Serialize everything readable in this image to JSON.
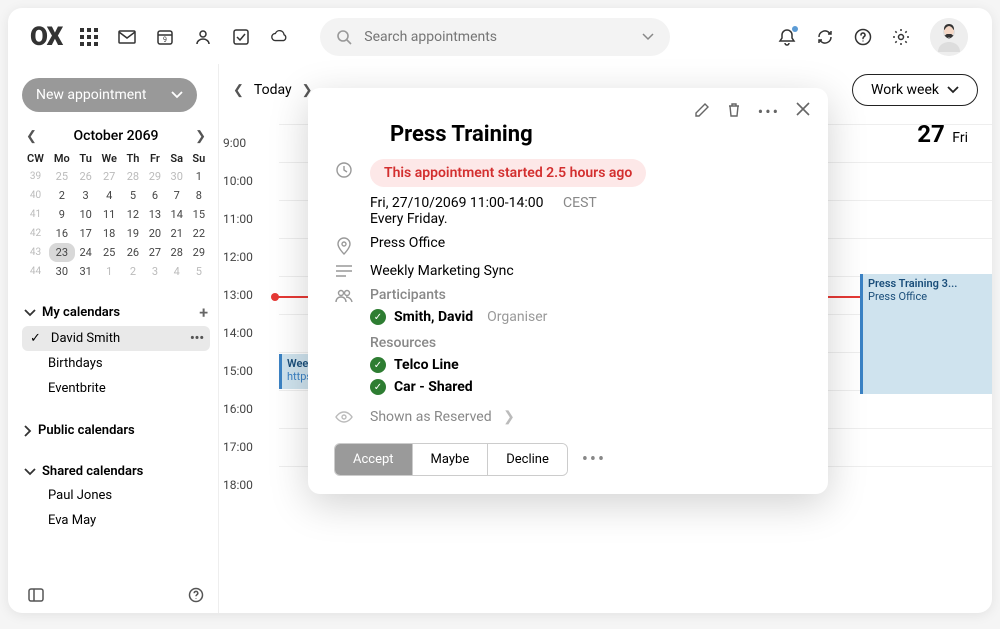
{
  "topbar": {
    "search_placeholder": "Search appointments"
  },
  "sidebar": {
    "new_appointment": "New appointment",
    "month_title": "October 2069",
    "calendars_header": "My calendars",
    "calendars": [
      {
        "name": "David Smith",
        "active": true
      },
      {
        "name": "Birthdays",
        "active": false
      },
      {
        "name": "Eventbrite",
        "active": false
      }
    ],
    "public_header": "Public calendars",
    "shared_header": "Shared calendars",
    "shared": [
      {
        "name": "Paul Jones"
      },
      {
        "name": "Eva May"
      }
    ],
    "mini": {
      "dow": [
        "CW",
        "Mo",
        "Tu",
        "We",
        "Th",
        "Fr",
        "Sa",
        "Su"
      ],
      "rows": [
        {
          "cw": "39",
          "days": [
            "25",
            "26",
            "27",
            "28",
            "29",
            "30",
            "1"
          ],
          "dim": [
            0,
            1,
            2,
            3,
            4,
            5
          ]
        },
        {
          "cw": "40",
          "days": [
            "2",
            "3",
            "4",
            "5",
            "6",
            "7",
            "8"
          ]
        },
        {
          "cw": "41",
          "days": [
            "9",
            "10",
            "11",
            "12",
            "13",
            "14",
            "15"
          ]
        },
        {
          "cw": "42",
          "days": [
            "16",
            "17",
            "18",
            "19",
            "20",
            "21",
            "22"
          ]
        },
        {
          "cw": "43",
          "days": [
            "23",
            "24",
            "25",
            "26",
            "27",
            "28",
            "29"
          ],
          "today": 0
        },
        {
          "cw": "44",
          "days": [
            "30",
            "31",
            "1",
            "2",
            "3",
            "4",
            "5"
          ],
          "dim": [
            2,
            3,
            4,
            5,
            6
          ]
        }
      ]
    }
  },
  "calendar": {
    "today_label": "Today",
    "view_label": "Work week",
    "day_num": "27",
    "day_name": "Fri",
    "hours": [
      "9:00",
      "10:00",
      "11:00",
      "12:00",
      "13:00",
      "14:00",
      "15:00",
      "16:00",
      "17:00",
      "18:00"
    ],
    "side_apt_title": "Press Training 3...",
    "side_apt_loc": "Press Office",
    "left_apt_title": "Weel",
    "left_apt_sub": "https"
  },
  "popup": {
    "title": "Press Training",
    "alert": "This appointment started 2.5 hours ago",
    "datetime": "Fri, 27/10/2069 11:00-14:00",
    "tz": "CEST",
    "recurrence": "Every Friday.",
    "location": "Press Office",
    "description": "Weekly Marketing Sync",
    "participants_label": "Participants",
    "participants": [
      {
        "name": "Smith, David",
        "role": "Organiser"
      }
    ],
    "resources_label": "Resources",
    "resources": [
      {
        "name": "Telco Line"
      },
      {
        "name": "Car - Shared"
      }
    ],
    "shown_as": "Shown as Reserved",
    "accept": "Accept",
    "maybe": "Maybe",
    "decline": "Decline"
  }
}
